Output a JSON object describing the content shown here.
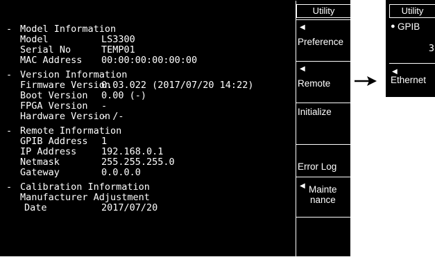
{
  "menu": {
    "title": "Utility",
    "keys": [
      {
        "label": "Preference"
      },
      {
        "label": "Remote"
      },
      {
        "label": "Initialize"
      },
      {
        "label": "Error Log"
      },
      {
        "label_line1": "Mainte",
        "label_line2": "nance"
      }
    ]
  },
  "sections": {
    "model": {
      "title": "Model Information",
      "rows": [
        {
          "label": "Model",
          "value": "LS3300"
        },
        {
          "label": "Serial No",
          "value": "TEMP01"
        },
        {
          "label": "MAC Address",
          "value": "00:00:00:00:00:00"
        }
      ]
    },
    "version": {
      "title": "Version Information",
      "rows": [
        {
          "label": "Firmware Version",
          "value": "0.03.022 (2017/07/20 14:22)"
        },
        {
          "label": "Boot Version",
          "value": "0.00 (-)"
        },
        {
          "label": "FPGA Version",
          "value": "-"
        },
        {
          "label": "Hardware Version",
          "value": "- /-"
        }
      ]
    },
    "remote": {
      "title": "Remote Information",
      "rows": [
        {
          "label": "GPIB Address",
          "value": "1"
        },
        {
          "label": "IP Address",
          "value": "192.168.0.1"
        },
        {
          "label": "Netmask",
          "value": "255.255.255.0"
        },
        {
          "label": "Gateway",
          "value": "0.0.0.0"
        }
      ]
    },
    "calibration": {
      "title": "Calibration Information",
      "line": "Manufacturer Adjustment",
      "date_label": "Date",
      "date_value": "2017/07/20"
    }
  },
  "inset": {
    "title": "Utility",
    "gpib_label": "GPIB",
    "gpib_value": "3",
    "ethernet_label": "Ethernet"
  },
  "colors": {
    "screen_bg": "#000000",
    "text": "#ffffff",
    "page_bg": "#ffffff"
  },
  "icons": {
    "left_triangle": "left-triangle-icon",
    "arrow": "right-arrow-icon",
    "radio": "radio-filled-icon"
  }
}
